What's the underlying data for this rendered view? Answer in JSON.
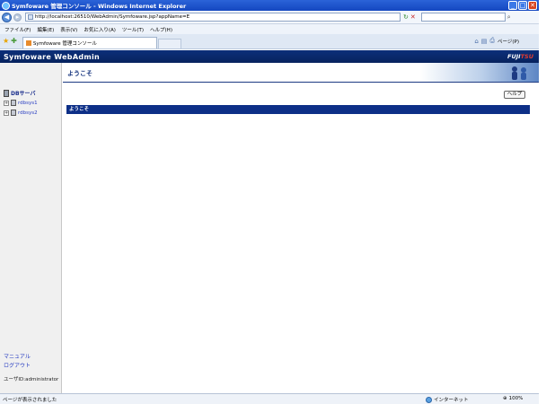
{
  "window": {
    "title": "Symfoware 管理コンソール - Windows Internet Explorer",
    "minimize": "_",
    "maximize": "□",
    "close": "✕"
  },
  "browser": {
    "back": "◀",
    "forward": "▸",
    "url": "http://localhost:26510/WebAdmin/Symfoware.jsp?appName=E",
    "refresh": "↻",
    "stop": "✕",
    "go": "▾",
    "search_icon": "⌕",
    "menu": [
      "ファイル(F)",
      "編集(E)",
      "表示(V)",
      "お気に入り(A)",
      "ツール(T)",
      "ヘルプ(H)"
    ],
    "tab_title": "Symfoware 管理コンソール",
    "command_bar": {
      "page": "ページ(P)"
    },
    "favorites_icon": "★",
    "add_fav_icon": "✚"
  },
  "app": {
    "product": "Symfoware WebAdmin",
    "logo_main": "FUJI",
    "logo_accent": "TSU"
  },
  "sidebar": {
    "root_label": "DBサーバ",
    "nodes": [
      {
        "label": "rdbsys1",
        "expander": "+"
      },
      {
        "label": "rdbsys2",
        "expander": "+"
      }
    ],
    "manual_link": "マニュアル",
    "logout_link": "ログアウト",
    "user_id": "ユーザID:administrator"
  },
  "main": {
    "heading": "ようこそ",
    "help_button": "ヘルプ",
    "section_title": "ようこそ"
  },
  "status": {
    "text": "ページが表示されました",
    "zone": "インターネット",
    "zoom": "100%"
  }
}
